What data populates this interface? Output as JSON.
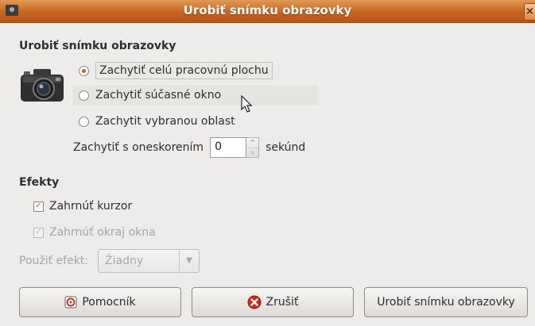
{
  "window": {
    "title": "Urobiť snímku obrazovky",
    "close_glyph": "×"
  },
  "capture": {
    "heading": "Urobiť snímku obrazovky",
    "icon": "camera-icon",
    "options": [
      {
        "label": "Zachytiť celú pracovnú plochu",
        "selected": true
      },
      {
        "label": "Zachytiť súčasné okno",
        "selected": false
      },
      {
        "label": "Zachytit vybranou oblast",
        "selected": false
      }
    ],
    "delay_label": "Zachytiť s oneskorením",
    "delay_value": "0",
    "delay_unit": "sekúnd",
    "spin_up": "^",
    "spin_down": "v"
  },
  "effects": {
    "heading": "Efekty",
    "include_pointer_label": "Zahrnúť kurzor",
    "include_pointer_checked": true,
    "include_border_label": "Zahrnúť okraj okna",
    "include_border_checked": true,
    "include_border_enabled": false,
    "apply_effect_label": "Použiť efekt:",
    "apply_effect_value": "Žiadny"
  },
  "buttons": {
    "help_label": "Pomocník",
    "cancel_label": "Zrušiť",
    "capture_label": "Urobiť snímku obrazovky"
  },
  "colors": {
    "accent": "#d05e14",
    "titlebar": "#c7641f"
  }
}
